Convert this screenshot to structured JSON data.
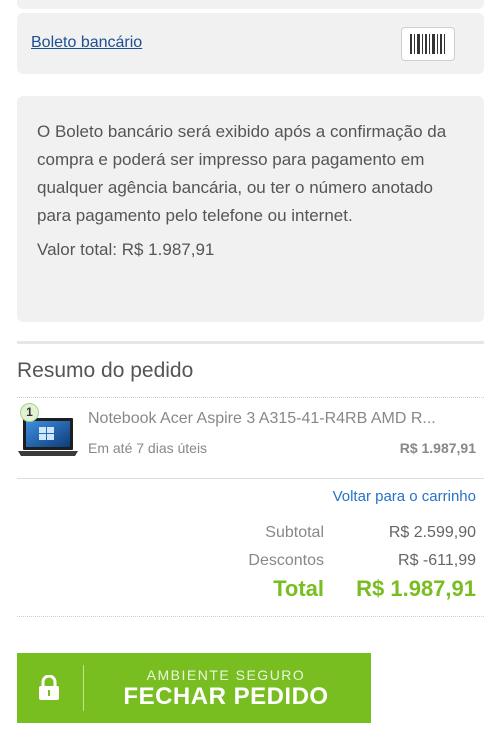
{
  "payment": {
    "option_label": "Boleto bancário",
    "barcode_icon": "barcode-icon",
    "info_text": "O Boleto bancário será exibido após a confirmação da compra e poderá ser impresso para pagamento em qualquer agência bancária, ou ter o número anotado para pagamento pelo telefone ou internet.",
    "total_line": "Valor total: R$ 1.987,91"
  },
  "summary": {
    "title": "Resumo do pedido",
    "items": [
      {
        "quantity": "1",
        "name": "Notebook Acer Aspire 3 A315-41-R4RB AMD R...",
        "delivery": "Em até 7 dias úteis",
        "price": "R$ 1.987,91",
        "thumb_icon": "laptop-icon"
      }
    ],
    "back_link": "Voltar para o carrinho",
    "subtotal_label": "Subtotal",
    "subtotal_value": "R$ 2.599,90",
    "discount_label": "Descontos",
    "discount_value": "R$ -611,99",
    "total_label": "Total",
    "total_value": "R$ 1.987,91"
  },
  "checkout": {
    "subtitle": "AMBIENTE SEGURO",
    "label": "FECHAR PEDIDO",
    "lock_icon": "lock-icon"
  },
  "colors": {
    "accent_green": "#78be20",
    "link_blue": "#1d4f91",
    "card_bg": "#f1f1f1"
  }
}
